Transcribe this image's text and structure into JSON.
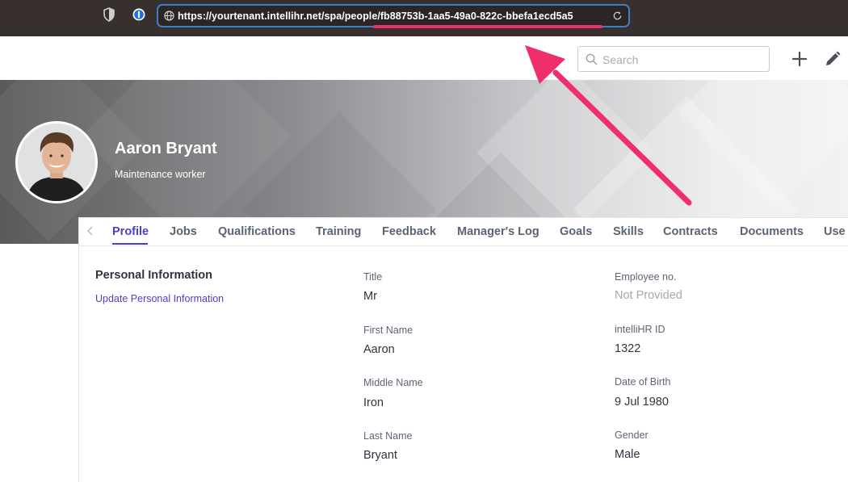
{
  "browser": {
    "url_prefix": "https://yourtenant",
    "url_rest": ".intellihr.net/spa/people/fb88753b-1aa5-49a0-822c-bbefa1ecd5a5"
  },
  "header": {
    "search_placeholder": "Search"
  },
  "profile": {
    "name": "Aaron Bryant",
    "role": "Maintenance worker"
  },
  "tabs": [
    {
      "label": "Profile",
      "active": true
    },
    {
      "label": "Jobs"
    },
    {
      "label": "Qualifications"
    },
    {
      "label": "Training"
    },
    {
      "label": "Feedback"
    },
    {
      "label": "Manager's Log"
    },
    {
      "label": "Goals"
    },
    {
      "label": "Skills"
    },
    {
      "label": "Contracts"
    },
    {
      "label": "Documents"
    },
    {
      "label": "Use"
    }
  ],
  "section": {
    "title": "Personal Information",
    "update_link": "Update Personal Information"
  },
  "fields_left": [
    {
      "label": "Title",
      "value": "Mr"
    },
    {
      "label": "First Name",
      "value": "Aaron"
    },
    {
      "label": "Middle Name",
      "value": "Iron"
    },
    {
      "label": "Last Name",
      "value": "Bryant"
    }
  ],
  "fields_right": [
    {
      "label": "Employee no.",
      "value": "Not Provided"
    },
    {
      "label": "intelliHR ID",
      "value": "1322"
    },
    {
      "label": "Date of Birth",
      "value": "9 Jul 1980"
    },
    {
      "label": "Gender",
      "value": "Male"
    }
  ],
  "colors": {
    "accent": "#4b3fd0",
    "annotation": "#ef2f6b",
    "browser_bar": "#38302f"
  },
  "icons": [
    "shield-icon",
    "password-manager-icon",
    "globe-icon",
    "reload-icon",
    "search-icon",
    "add-icon",
    "edit-pencil-icon",
    "chevron-left-icon"
  ]
}
